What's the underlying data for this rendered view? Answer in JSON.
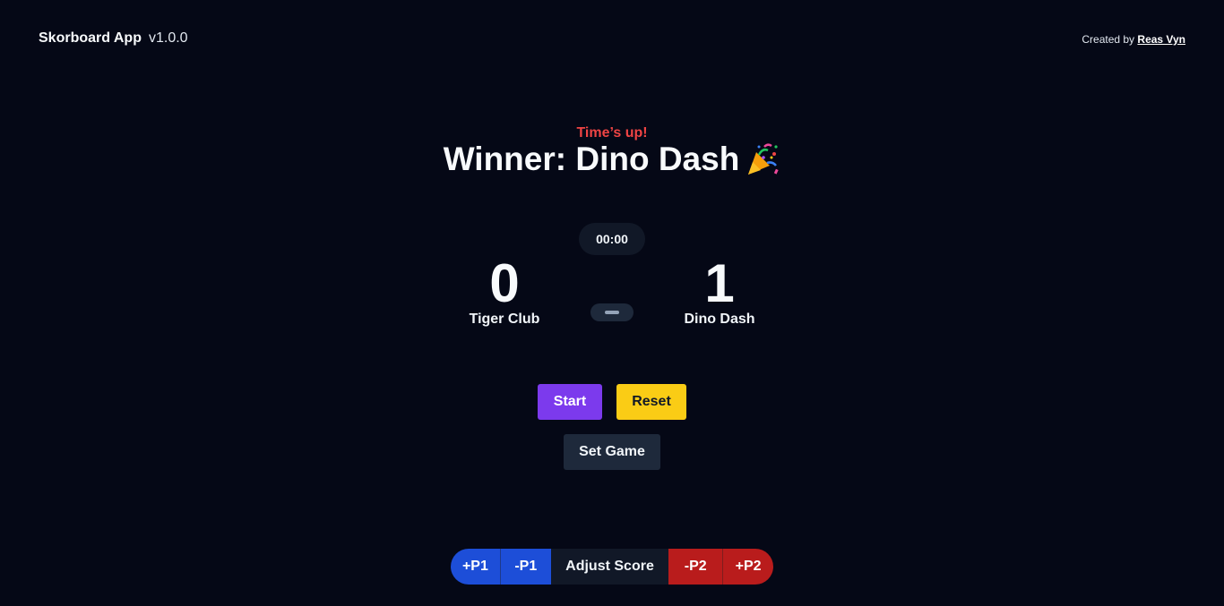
{
  "header": {
    "app_name": "Skorboard App",
    "version": "v1.0.0",
    "credit_prefix": "Created by",
    "credit_author": "Reas Vyn"
  },
  "status": {
    "message": "Time’s up!",
    "winner_text": "Winner: Dino Dash",
    "winner_icon": "party-popper-icon"
  },
  "timer": {
    "value": "00:00"
  },
  "teams": [
    {
      "name": "Tiger Club",
      "score": "0"
    },
    {
      "name": "Dino Dash",
      "score": "1"
    }
  ],
  "controls": {
    "start_label": "Start",
    "reset_label": "Reset",
    "set_game_label": "Set Game"
  },
  "adjust": {
    "p1_plus": "+P1",
    "p1_minus": "-P1",
    "label": "Adjust Score",
    "p2_minus": "-P2",
    "p2_plus": "+P2"
  },
  "colors": {
    "background": "#050816",
    "status_red": "#ef4444",
    "start_purple": "#7c3aed",
    "reset_yellow": "#facc15",
    "p1_blue": "#1d4ed8",
    "p2_red": "#b91c1c"
  }
}
